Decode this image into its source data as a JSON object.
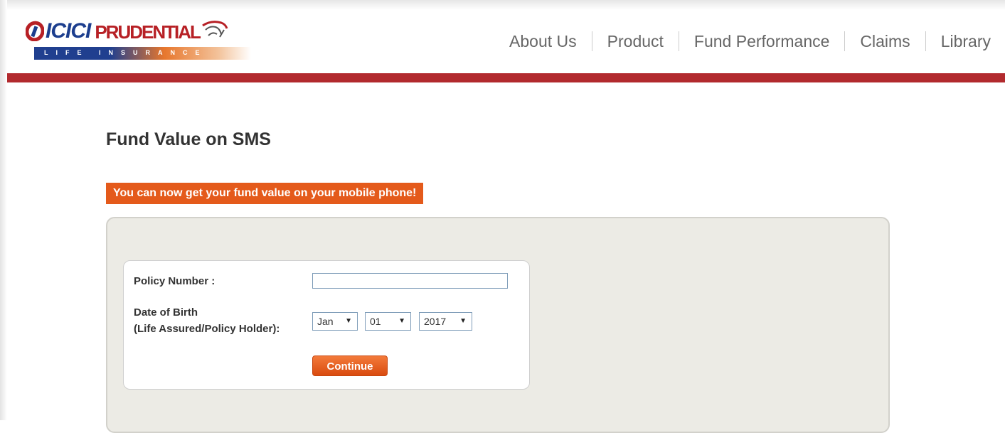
{
  "header": {
    "logo": {
      "brand_primary": "ICICI",
      "brand_secondary": "PRUDENTIAL",
      "tagline": "LIFE INSURANCE"
    },
    "nav": [
      {
        "label": "About Us"
      },
      {
        "label": "Product"
      },
      {
        "label": "Fund Performance"
      },
      {
        "label": "Claims"
      },
      {
        "label": "Library"
      }
    ]
  },
  "main": {
    "title": "Fund Value on SMS",
    "banner": "You can now get your fund value on your mobile phone!",
    "form": {
      "policy_number_label": "Policy Number :",
      "policy_number_value": "",
      "dob_label_line1": "Date of Birth",
      "dob_label_line2": "(Life Assured/Policy Holder):",
      "dob_month": "Jan",
      "dob_day": "01",
      "dob_year": "2017",
      "continue_label": "Continue"
    }
  },
  "colors": {
    "brand_blue": "#1c3e8e",
    "brand_red": "#b72025",
    "header_bar": "#b22a2e",
    "banner": "#e45a1b",
    "button": "#e05a1c",
    "panel": "#ecebe5"
  },
  "icons": {
    "logo_mark": "icici-logo-mark-icon",
    "logo_mascot": "lion-mascot-icon",
    "dropdown": "dropdown-arrow-icon"
  }
}
